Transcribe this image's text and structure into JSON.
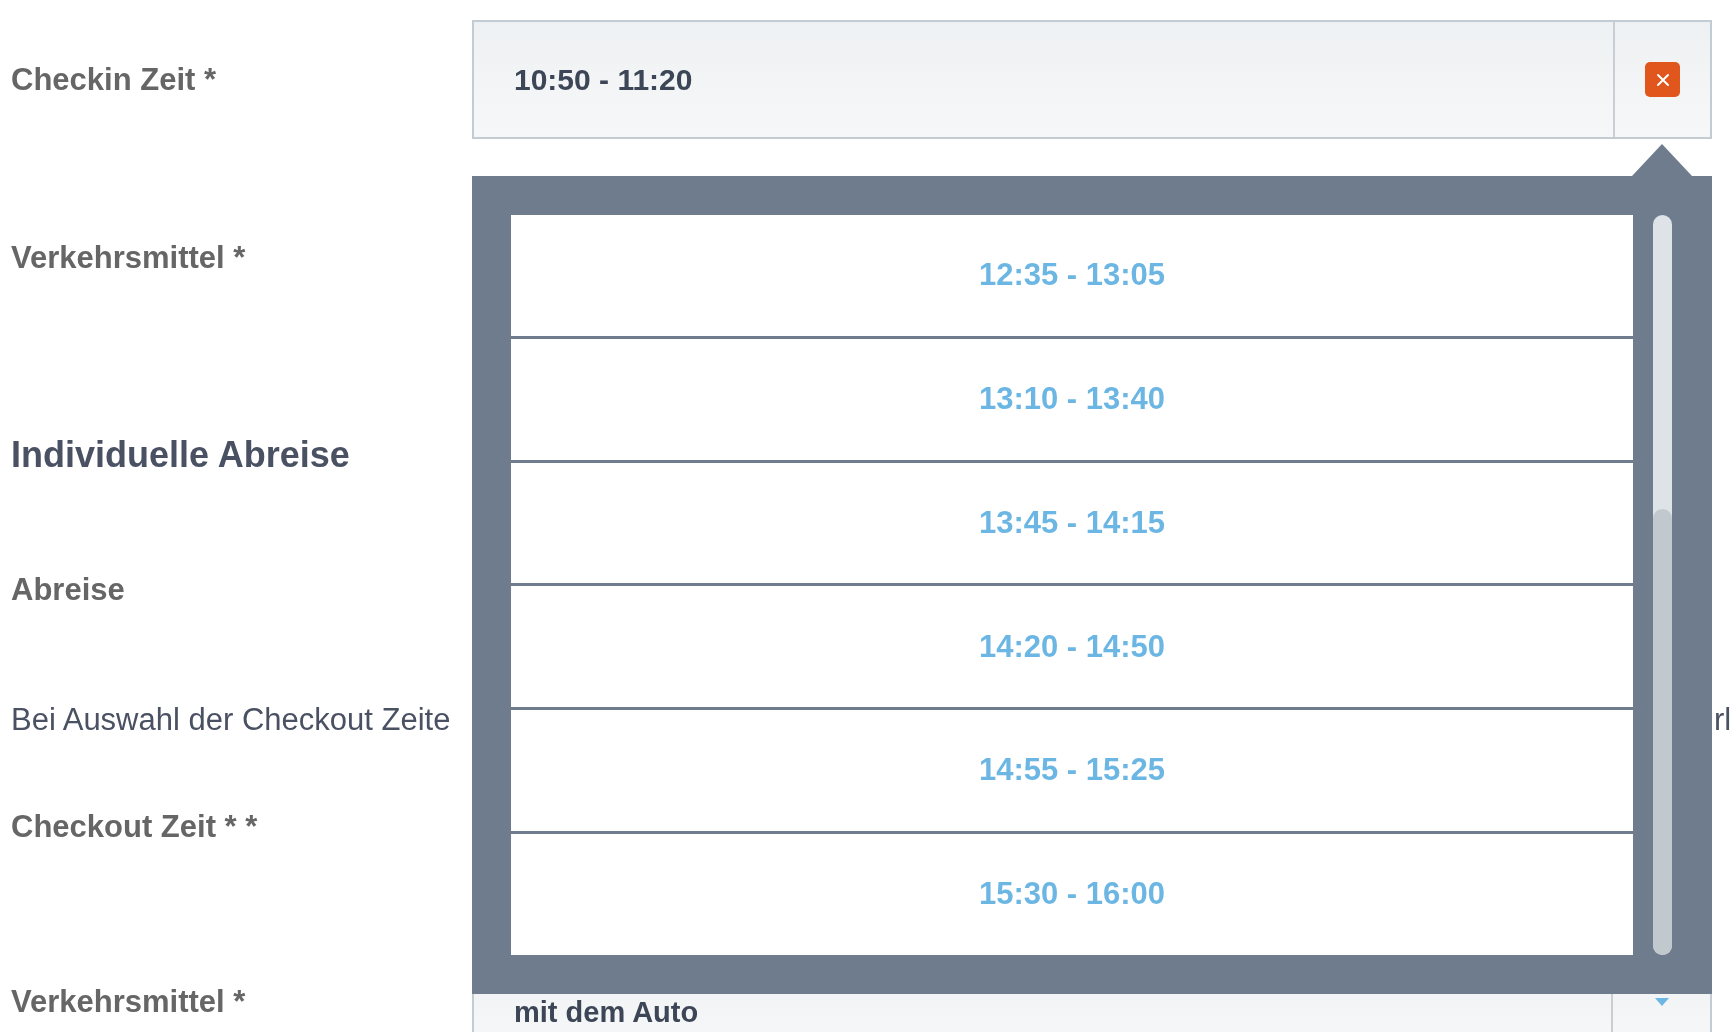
{
  "checkin": {
    "label": "Checkin Zeit *",
    "value": "10:50 - 11:20"
  },
  "transport_label": "Verkehrsmittel *",
  "section_title": "Individuelle Abreise",
  "departure_label": "Abreise",
  "note_fragments": [
    "Bei Auswahl der Checkout Zeite",
    "rl"
  ],
  "checkout_label": "Checkout Zeit * *",
  "transport": {
    "label": "Verkehrsmittel *",
    "value": "mit dem Auto"
  },
  "dropdown": {
    "options": [
      "12:35 - 13:05",
      "13:10 - 13:40",
      "13:45 - 14:15",
      "14:20 - 14:50",
      "14:55 - 15:25",
      "15:30 - 16:00"
    ]
  }
}
